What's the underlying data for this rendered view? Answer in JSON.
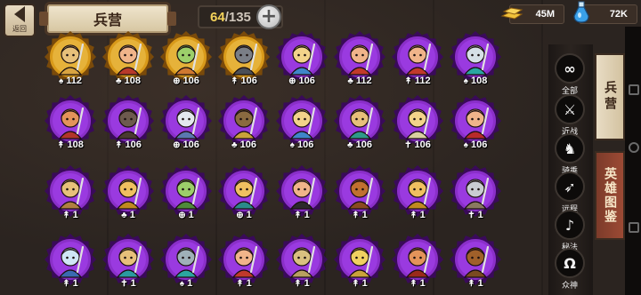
{
  "header": {
    "back_label": "返回",
    "title": "兵营",
    "capacity_current": "64",
    "capacity_max": "/135",
    "plus_symbol": "+",
    "gold": "45M",
    "gems": "72K"
  },
  "filters": [
    {
      "symbol": "∞",
      "label": "全部"
    },
    {
      "symbol": "⚔",
      "label": "近战"
    },
    {
      "symbol": "♞",
      "label": "骑乘"
    },
    {
      "symbol": "➶",
      "label": "远程"
    },
    {
      "symbol": "♪",
      "label": "秘法"
    },
    {
      "symbol": "Ω",
      "label": "众神"
    }
  ],
  "tabs": [
    {
      "label": "兵营",
      "active": true
    },
    {
      "label": "英雄图鉴",
      "active": false
    }
  ],
  "units": [
    {
      "count": "112",
      "icon": "♠",
      "ring": "gold",
      "skin": "#e7c07a",
      "color": "#d9a441"
    },
    {
      "count": "108",
      "icon": "♣",
      "ring": "gold",
      "skin": "#f0b48a",
      "color": "#b8392a"
    },
    {
      "count": "106",
      "icon": "⊕",
      "ring": "gold",
      "skin": "#9ccf6a",
      "color": "#d07830"
    },
    {
      "count": "106",
      "icon": "↟",
      "ring": "gold",
      "skin": "#7a7e86",
      "color": "#4b4f57"
    },
    {
      "count": "106",
      "icon": "⊕",
      "ring": "purple",
      "skin": "#f2d38a",
      "color": "#3f86c9"
    },
    {
      "count": "112",
      "icon": "♣",
      "ring": "purple",
      "skin": "#f0b48a",
      "color": "#c23a2a"
    },
    {
      "count": "112",
      "icon": "↟",
      "ring": "purple",
      "skin": "#f0b48a",
      "color": "#c0392b"
    },
    {
      "count": "108",
      "icon": "♠",
      "ring": "purple",
      "skin": "#d6e0e6",
      "color": "#2aa6a0"
    },
    {
      "count": "108",
      "icon": "↟",
      "ring": "purple",
      "skin": "#e3935a",
      "color": "#b2352a"
    },
    {
      "count": "106",
      "icon": "↟",
      "ring": "purple",
      "skin": "#6d5a4e",
      "color": "#4a3a30"
    },
    {
      "count": "106",
      "icon": "⊕",
      "ring": "purple",
      "skin": "#e3e8ee",
      "color": "#5a78b0"
    },
    {
      "count": "106",
      "icon": "♣",
      "ring": "purple",
      "skin": "#8a6a40",
      "color": "#c9a23a"
    },
    {
      "count": "106",
      "icon": "♠",
      "ring": "purple",
      "skin": "#f2d38a",
      "color": "#3f86c9"
    },
    {
      "count": "106",
      "icon": "♣",
      "ring": "purple",
      "skin": "#e7c07a",
      "color": "#2e9a8a"
    },
    {
      "count": "106",
      "icon": "✝",
      "ring": "purple",
      "skin": "#f2d38a",
      "color": "#d8d0a0"
    },
    {
      "count": "106",
      "icon": "♠",
      "ring": "purple",
      "skin": "#f0b48a",
      "color": "#b82a2a"
    },
    {
      "count": "1",
      "icon": "↟",
      "ring": "purple",
      "skin": "#e7c07a",
      "color": "#b08040"
    },
    {
      "count": "1",
      "icon": "♣",
      "ring": "purple",
      "skin": "#f0c060",
      "color": "#c08a20"
    },
    {
      "count": "1",
      "icon": "⊕",
      "ring": "purple",
      "skin": "#9ccf6a",
      "color": "#4f8a3a"
    },
    {
      "count": "1",
      "icon": "⊕",
      "ring": "purple",
      "skin": "#f0c060",
      "color": "#2a8a8a"
    },
    {
      "count": "1",
      "icon": "↟",
      "ring": "purple",
      "skin": "#f0b48a",
      "color": "#2a2a2a"
    },
    {
      "count": "1",
      "icon": "↟",
      "ring": "purple",
      "skin": "#c07030",
      "color": "#8a4a20"
    },
    {
      "count": "1",
      "icon": "↟",
      "ring": "purple",
      "skin": "#f0c060",
      "color": "#c08a20"
    },
    {
      "count": "1",
      "icon": "✝",
      "ring": "purple",
      "skin": "#c9ccd2",
      "color": "#8a7a60"
    },
    {
      "count": "1",
      "icon": "↟",
      "ring": "purple",
      "skin": "#cfe6f5",
      "color": "#3a6ab0"
    },
    {
      "count": "1",
      "icon": "✝",
      "ring": "purple",
      "skin": "#e7c07a",
      "color": "#2a9aa0"
    },
    {
      "count": "1",
      "icon": "♠",
      "ring": "purple",
      "skin": "#9fb0b8",
      "color": "#2aa6a0"
    },
    {
      "count": "1",
      "icon": "↟",
      "ring": "purple",
      "skin": "#f0b48a",
      "color": "#c0392b"
    },
    {
      "count": "1",
      "icon": "↟",
      "ring": "purple",
      "skin": "#d9c080",
      "color": "#b8a060"
    },
    {
      "count": "1",
      "icon": "↟",
      "ring": "purple",
      "skin": "#f0d060",
      "color": "#c9a23a"
    },
    {
      "count": "1",
      "icon": "↟",
      "ring": "purple",
      "skin": "#e3935a",
      "color": "#9a2a1a"
    },
    {
      "count": "1",
      "icon": "↟",
      "ring": "purple",
      "skin": "#a0602a",
      "color": "#7a4a20"
    }
  ],
  "colors": {
    "purple_ring": "#8a2fc9",
    "gold_ring": "#d99a1a",
    "tab_active": "#e0d2b4",
    "tab_inactive": "#8c4430"
  }
}
